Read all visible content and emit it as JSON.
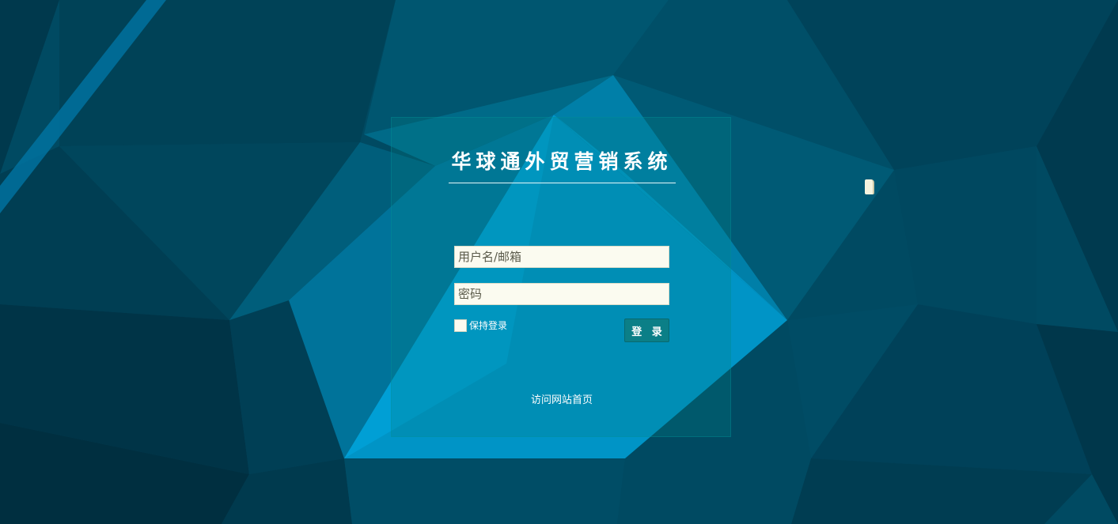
{
  "app": {
    "title": "华球通外贸营销系统"
  },
  "login": {
    "username_placeholder": "用户名/邮箱",
    "password_placeholder": "密码",
    "remember_label": "保持登录",
    "submit_label": "登 录",
    "home_link": "访问网站首页"
  },
  "colors": {
    "background_dark": "#003f55",
    "background_mid": "#005a73",
    "accent_light": "#00a6e0",
    "button": "#0b7f87",
    "input_bg": "#fbfbf0"
  },
  "icons": {
    "floating": "note-icon"
  }
}
